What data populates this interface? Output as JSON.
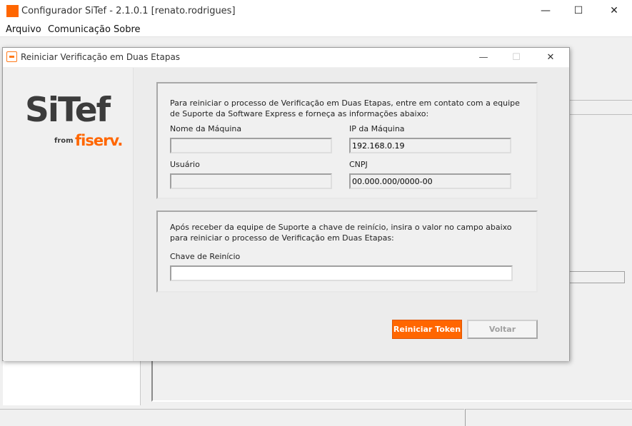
{
  "main_window": {
    "title": "Configurador SiTef - 2.1.0.1  [renato.rodrigues]",
    "controls": {
      "minimize": "—",
      "maximize": "☐",
      "close": "✕"
    },
    "menu": [
      "Arquivo",
      "Comunicação",
      "Sobre"
    ]
  },
  "dialog": {
    "title": "Reiniciar Verificação em Duas Etapas",
    "controls": {
      "minimize": "—",
      "maximize": "☐",
      "close": "✕"
    },
    "logo": {
      "brand": "SiTef",
      "from": "from",
      "partner": "fiserv."
    },
    "section1": {
      "instructions_line1": "Para reiniciar o processo de Verificação em Duas Etapas, entre em contato com a equipe",
      "instructions_line2": "de Suporte da Software Express e forneça as informações abaixo:",
      "machine_name_label": "Nome da Máquina",
      "machine_name_value": "",
      "machine_ip_label": "IP da Máquina",
      "machine_ip_value": "192.168.0.19",
      "user_label": "Usuário",
      "user_value": "",
      "cnpj_label": "CNPJ",
      "cnpj_value": "00.000.000/0000-00"
    },
    "section2": {
      "instructions_line1": "Após receber da equipe de Suporte a chave de reinício, insira o valor no campo abaixo",
      "instructions_line2": "para reiniciar o processo de Verificação em Duas Etapas:",
      "key_label": "Chave de Reinício",
      "key_value": ""
    },
    "buttons": {
      "restart": "Reiniciar Token",
      "back": "Voltar"
    }
  },
  "colors": {
    "brand": "#ff6600",
    "logo_text": "#3c3c3c"
  }
}
